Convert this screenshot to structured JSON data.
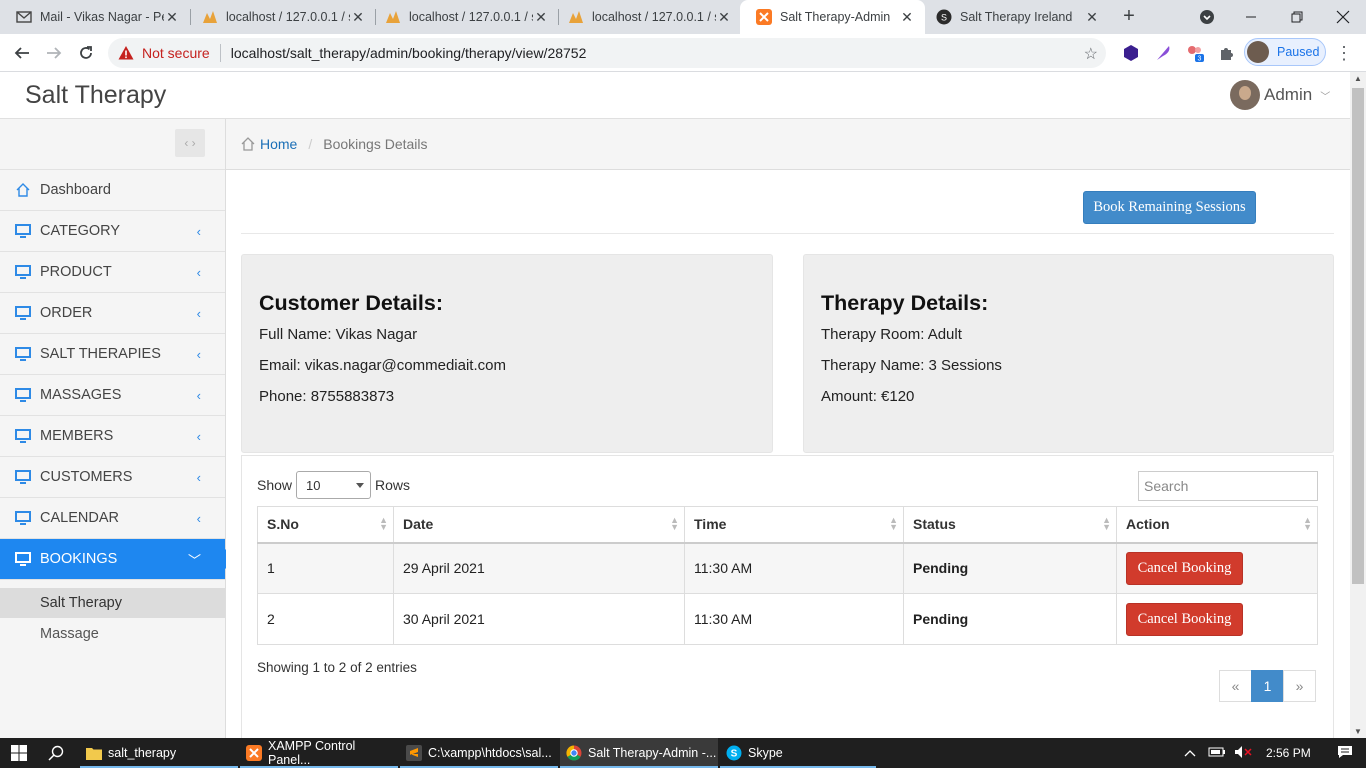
{
  "browser": {
    "tabs": [
      {
        "title": "Mail - Vikas Nagar - Pe",
        "icon": "mail-icon"
      },
      {
        "title": "localhost / 127.0.0.1 / s",
        "icon": "phpmyadmin-icon"
      },
      {
        "title": "localhost / 127.0.0.1 / s",
        "icon": "phpmyadmin-icon"
      },
      {
        "title": "localhost / 127.0.0.1 / s",
        "icon": "phpmyadmin-icon"
      },
      {
        "title": "Salt Therapy-Admin",
        "icon": "xampp-icon"
      },
      {
        "title": "Salt Therapy Ireland",
        "icon": "site-icon"
      }
    ],
    "active_tab": 4,
    "security_label": "Not secure",
    "url": "localhost/salt_therapy/admin/booking/therapy/view/28752",
    "profile_label": "Paused",
    "extension_badge": "3"
  },
  "app": {
    "brand": "Salt Therapy",
    "user_name": "Admin"
  },
  "sidebar": {
    "items": [
      {
        "label": "Dashboard",
        "icon": "home-icon"
      },
      {
        "label": "CATEGORY",
        "icon": "monitor-icon"
      },
      {
        "label": "PRODUCT",
        "icon": "monitor-icon"
      },
      {
        "label": "ORDER",
        "icon": "monitor-icon"
      },
      {
        "label": "SALT THERAPIES",
        "icon": "monitor-icon"
      },
      {
        "label": "MASSAGES",
        "icon": "monitor-icon"
      },
      {
        "label": "MEMBERS",
        "icon": "monitor-icon"
      },
      {
        "label": "CUSTOMERS",
        "icon": "monitor-icon"
      },
      {
        "label": "CALENDAR",
        "icon": "monitor-icon"
      },
      {
        "label": "BOOKINGS",
        "icon": "monitor-icon"
      }
    ],
    "sub_items": [
      {
        "label": "Salt Therapy"
      },
      {
        "label": "Massage"
      }
    ]
  },
  "breadcrumb": {
    "home": "Home",
    "current": "Bookings Details"
  },
  "actions": {
    "book_remaining": "Book Remaining Sessions"
  },
  "customer": {
    "heading": "Customer Details:",
    "full_name": "Full Name: Vikas Nagar",
    "email": "Email: vikas.nagar@commediait.com",
    "phone": "Phone: 8755883873"
  },
  "therapy": {
    "heading": "Therapy Details:",
    "room": "Therapy Room: Adult",
    "name": "Therapy Name: 3 Sessions",
    "amount": "Amount: €120"
  },
  "table": {
    "show_label": "Show",
    "rows_label": "Rows",
    "page_size": "10",
    "search_placeholder": "Search",
    "columns": [
      "S.No",
      "Date",
      "Time",
      "Status",
      "Action"
    ],
    "rows": [
      {
        "sno": "1",
        "date": "29 April 2021",
        "time": "11:30 AM",
        "status": "Pending",
        "action": "Cancel Booking"
      },
      {
        "sno": "2",
        "date": "30 April 2021",
        "time": "11:30 AM",
        "status": "Pending",
        "action": "Cancel Booking"
      }
    ],
    "info": "Showing 1 to 2 of 2 entries",
    "pager": {
      "prev": "«",
      "current": "1",
      "next": "»"
    }
  },
  "taskbar": {
    "items": [
      {
        "label": "salt_therapy",
        "icon": "folder-icon"
      },
      {
        "label": "XAMPP Control Panel...",
        "icon": "xampp-icon"
      },
      {
        "label": "C:\\xampp\\htdocs\\sal...",
        "icon": "sublime-icon"
      },
      {
        "label": "Salt Therapy-Admin -...",
        "icon": "chrome-icon"
      },
      {
        "label": "Skype",
        "icon": "skype-icon"
      }
    ],
    "clock": "2:56 PM"
  },
  "colors": {
    "accent": "#1e87f0",
    "primary_button": "#428bca",
    "danger_button": "#d13b2c"
  }
}
